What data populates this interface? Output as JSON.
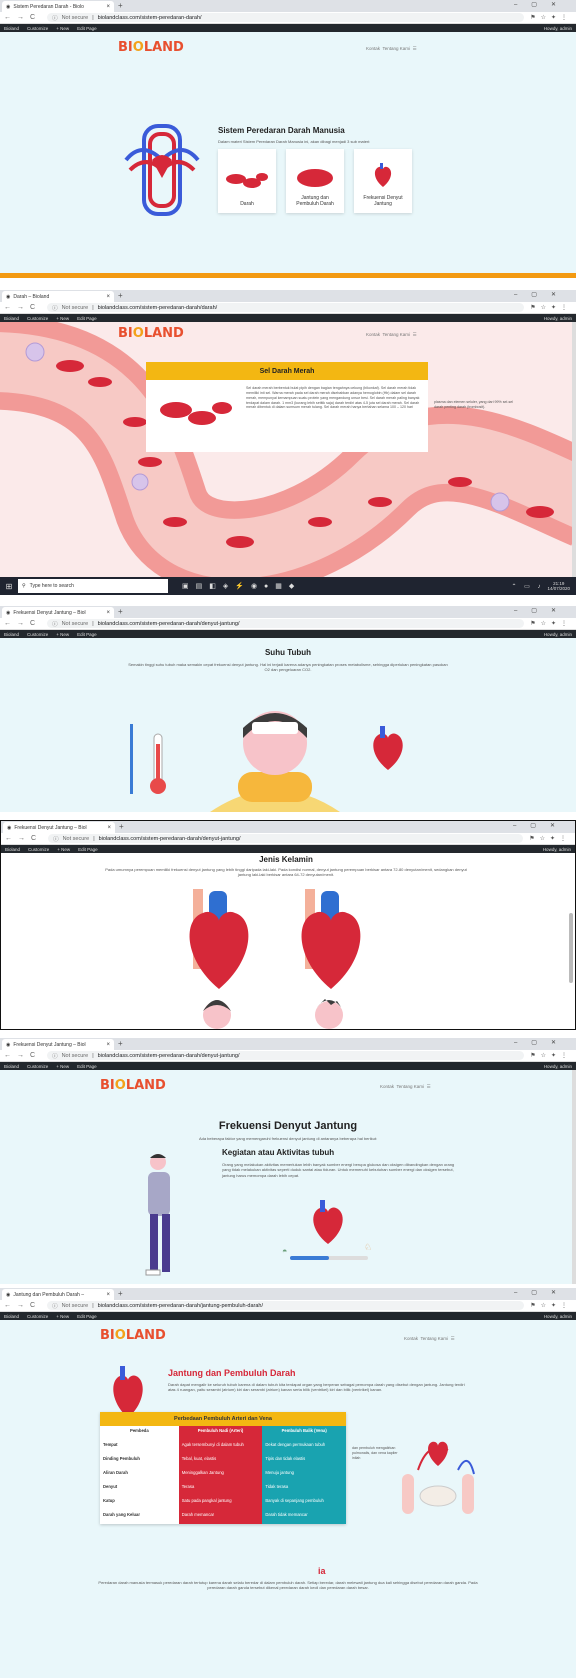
{
  "shots": [
    {
      "tab_title": "Sistem Peredaran Darah - Biolo",
      "not_secure": "Not secure",
      "url": "biolandclass.com/sistem-peredaran-darah/",
      "logo": "BIOLAND",
      "nav": [
        "Kontak",
        "Tentang Kami",
        "☰"
      ],
      "title": "Sistem Peredaran Darah Manusia",
      "subtitle": "Dalam materi Sistem Peredaran Darah Manusia ini, akan dibagi menjadi 3 sub materi:",
      "cards": [
        "Darah",
        "Jantung dan Pembuluh Darah",
        "Frekuensi Denyut Jantung"
      ]
    },
    {
      "tab_title": "Darah – Bioland",
      "not_secure": "Not secure",
      "url": "biolandclass.com/sistem-peredaran-darah/darah/",
      "logo": "BIOLAND",
      "nav": [
        "Kontak",
        "Tentang Kami",
        "☰"
      ],
      "title": "Sel Darah Merah",
      "body": "Sel darah merah berbentuk bulat pipih dengan bagian tengahnya cekung (bikonkaf). Sel darah merah tidak memiliki inti sel. Warna merah pada sel darah merah disebabkan adanya hemoglobin (Hb) dalam sel darah merah, mempunyai kemampuan suatu protein yang mengandung unsur besi. Sel darah merah paling banyak terdapat dalam darah. 1 mm3 (kurang lebih setitik saja) darah terdiri atas 4-5 juta sel darah merah. Sel darah merah dibentuk di dalam sumsum merah tulang. Sel darah merah hanya bertahan selama 100 – 120 hari",
      "side_text": "plasma dan elemen seluler, yang dari 99% sel-sel darah penting darah (trombosit).",
      "taskbar_search": "Type here to search",
      "time": "21:19",
      "date": "14/07/2020"
    },
    {
      "tab_title": "Frekuensi Denyut Jantung – Biol",
      "not_secure": "Not secure",
      "url": "biolandclass.com/sistem-peredaran-darah/denyut-jantung/",
      "title": "Suhu Tubuh",
      "body": "Semakin tinggi suhu tubuh maka semakin cepat frekuensi denyut jantung. Hal ini terjadi karena adanya peningkatan proses metabolisme, sehingga diperlukan peningkatan pasokan O2 dan pengeluaran CO2."
    },
    {
      "tab_title": "Frekuensi Denyut Jantung – Biol",
      "not_secure": "Not secure",
      "url": "biolandclass.com/sistem-peredaran-darah/denyut-jantung/",
      "title": "Jenis Kelamin",
      "body": "Pada umumnya perempuan memiliki frekuensi denyut jantung yang lebih tinggi daripada laki-laki. Pada kondisi normal, denyut jantung perempuan berkisar antara 72-80 denyutan/menit, sedangkan denyut jantung laki-laki berkisar antara 64-72 denyutan/menit."
    },
    {
      "tab_title": "Frekuensi Denyut Jantung – Biol",
      "not_secure": "Not secure",
      "url": "biolandclass.com/sistem-peredaran-darah/denyut-jantung/",
      "logo": "BIOLAND",
      "nav": [
        "Kontak",
        "Tentang Kami",
        "☰"
      ],
      "title": "Frekuensi Denyut Jantung",
      "subtitle": "Ada beberapa faktor yang memengaruhi frekuensi denyut jantung di antaranya beberapa hal berikut:",
      "section_title": "Kegiatan atau Aktivitas tubuh",
      "body": "Orang yang melakukan aktivitas memerlukan lebih banyak sumber energi berupa glukosa dan oksigen dibandingkan dengan orang yang tidak melakukan aktivitas seperti duduk santai atau tiduran. Untuk memenuhi kebutuhan sumber energi dan oksigen tersebut, jantung harus memompa darah lebih cepat."
    },
    {
      "tab_title": "Jantung dan Pembuluh Darah –",
      "not_secure": "Not secure",
      "url": "biolandclass.com/sistem-peredaran-darah/jantung-pembuluh-darah/",
      "logo": "BIOLAND",
      "nav": [
        "Kontak",
        "Tentang Kami",
        "☰"
      ],
      "title": "Jantung dan Pembuluh Darah",
      "body": "Darah dapat mengalir ke seluruh tubuh karena di dalam tubuh kita terdapat organ yang berperan sebagai pemompa darah yang disebut dengan jantung. Jantung terdiri atas 4 ruangan, yaitu serambi (atrium) kiri dan serambi (atrium) kanan serta bilik (ventrikel) kiri dan bilik (ventrikel) kanan.",
      "table_title": "Perbedaan Pembuluh Arteri dan Vena",
      "columns": [
        "Pembeda",
        "Pembuluh Nadi (Arteri)",
        "Pembuluh Balik (Vena)"
      ],
      "rows": [
        [
          "Tempat",
          "Agak tersembunyi di dalam tubuh",
          "Dekat dengan permukaan tubuh"
        ],
        [
          "Dinding Pembuluh",
          "Tebal, kuat, elastis",
          "Tipis dan tidak elastis"
        ],
        [
          "Aliran Darah",
          "Meninggalkan Jantung",
          "Menuju jantung"
        ],
        [
          "Denyut",
          "Terasa",
          "Tidak terasa"
        ],
        [
          "Katup",
          "Satu pada pangkal jantung",
          "Banyak di sepanjang pembuluh"
        ],
        [
          "Darah yang Keluar",
          "Darah memancar",
          "Darah tidak memancar"
        ]
      ],
      "side_text": "dan pembuluh mengalirkan pulmonalis, dan vena kapiler inilah",
      "bottom_heading_tail": "ia",
      "bottom_text": "Peredaran darah manusia termasuk peredaran darah tertutup karena darah selalu beredar di dalam pembuluh darah. Setiap beredar, darah melewati jantung dua kali sehingga disebut peredaran darah ganda. Pada peredaran darah ganda tersebut dikenal peredaran darah kecil dan peredaran darah besar."
    }
  ],
  "browser": {
    "howdy": "Howdy, admin",
    "wp_items": [
      "Bioland",
      "Customize",
      "7",
      "0",
      "+ New",
      "Edit Page"
    ]
  },
  "colors": {
    "accent": "#f3b712",
    "brand": "#e8502f",
    "red": "#d62839",
    "teal": "#19a3b0",
    "page_bg": "#e9f7fa"
  }
}
